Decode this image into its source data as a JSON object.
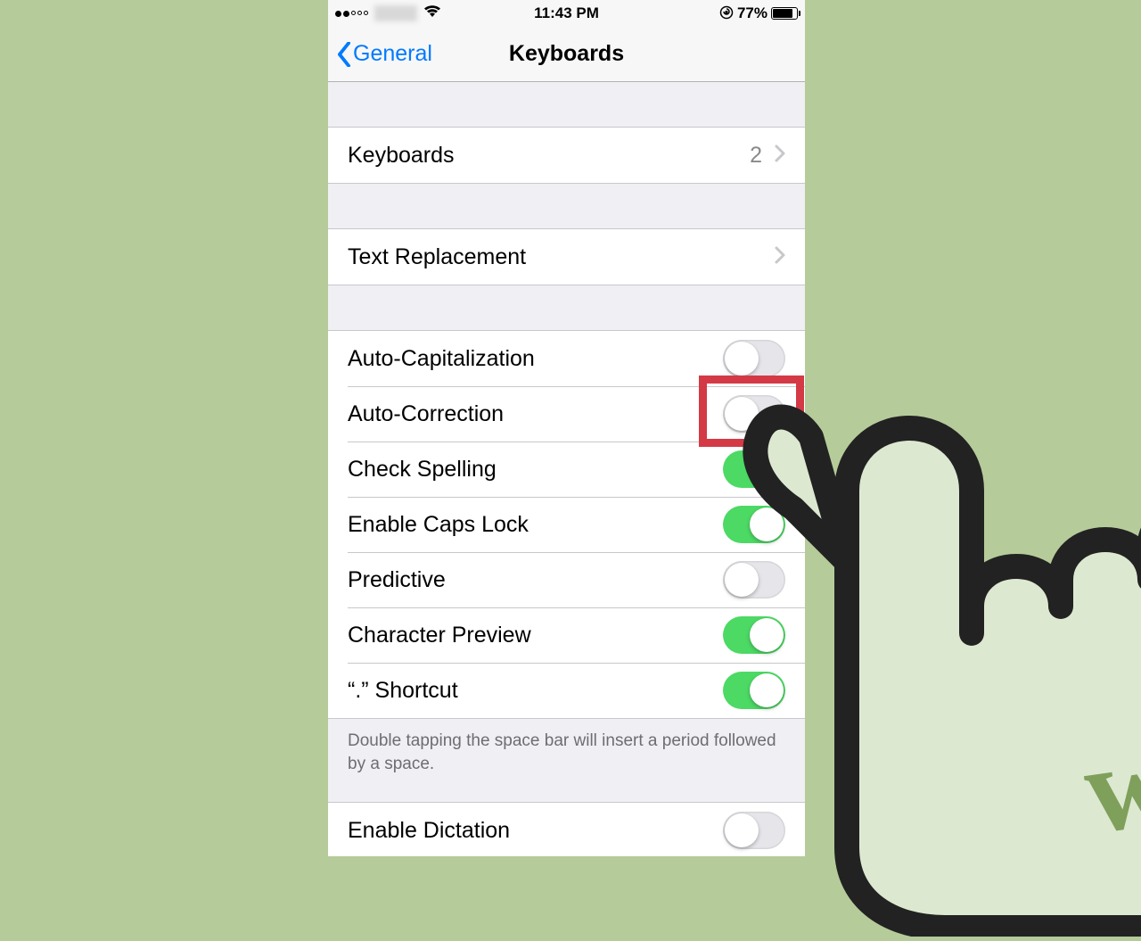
{
  "status": {
    "time": "11:43 PM",
    "battery_percent": "77%"
  },
  "nav": {
    "back_label": "General",
    "title": "Keyboards"
  },
  "rows": {
    "keyboards_label": "Keyboards",
    "keyboards_count": "2",
    "text_replacement_label": "Text Replacement",
    "auto_cap": "Auto-Capitalization",
    "auto_correct": "Auto-Correction",
    "check_spelling": "Check Spelling",
    "caps_lock": "Enable Caps Lock",
    "predictive": "Predictive",
    "char_preview": "Character Preview",
    "period_shortcut": "“.” Shortcut",
    "enable_dictation": "Enable Dictation"
  },
  "footer": "Double tapping the space bar will insert a period followed by a space.",
  "toggles": {
    "auto_cap": false,
    "auto_correct": false,
    "check_spelling": true,
    "caps_lock": true,
    "predictive": false,
    "char_preview": true,
    "period_shortcut": true,
    "enable_dictation": false
  },
  "watermark": "wH"
}
